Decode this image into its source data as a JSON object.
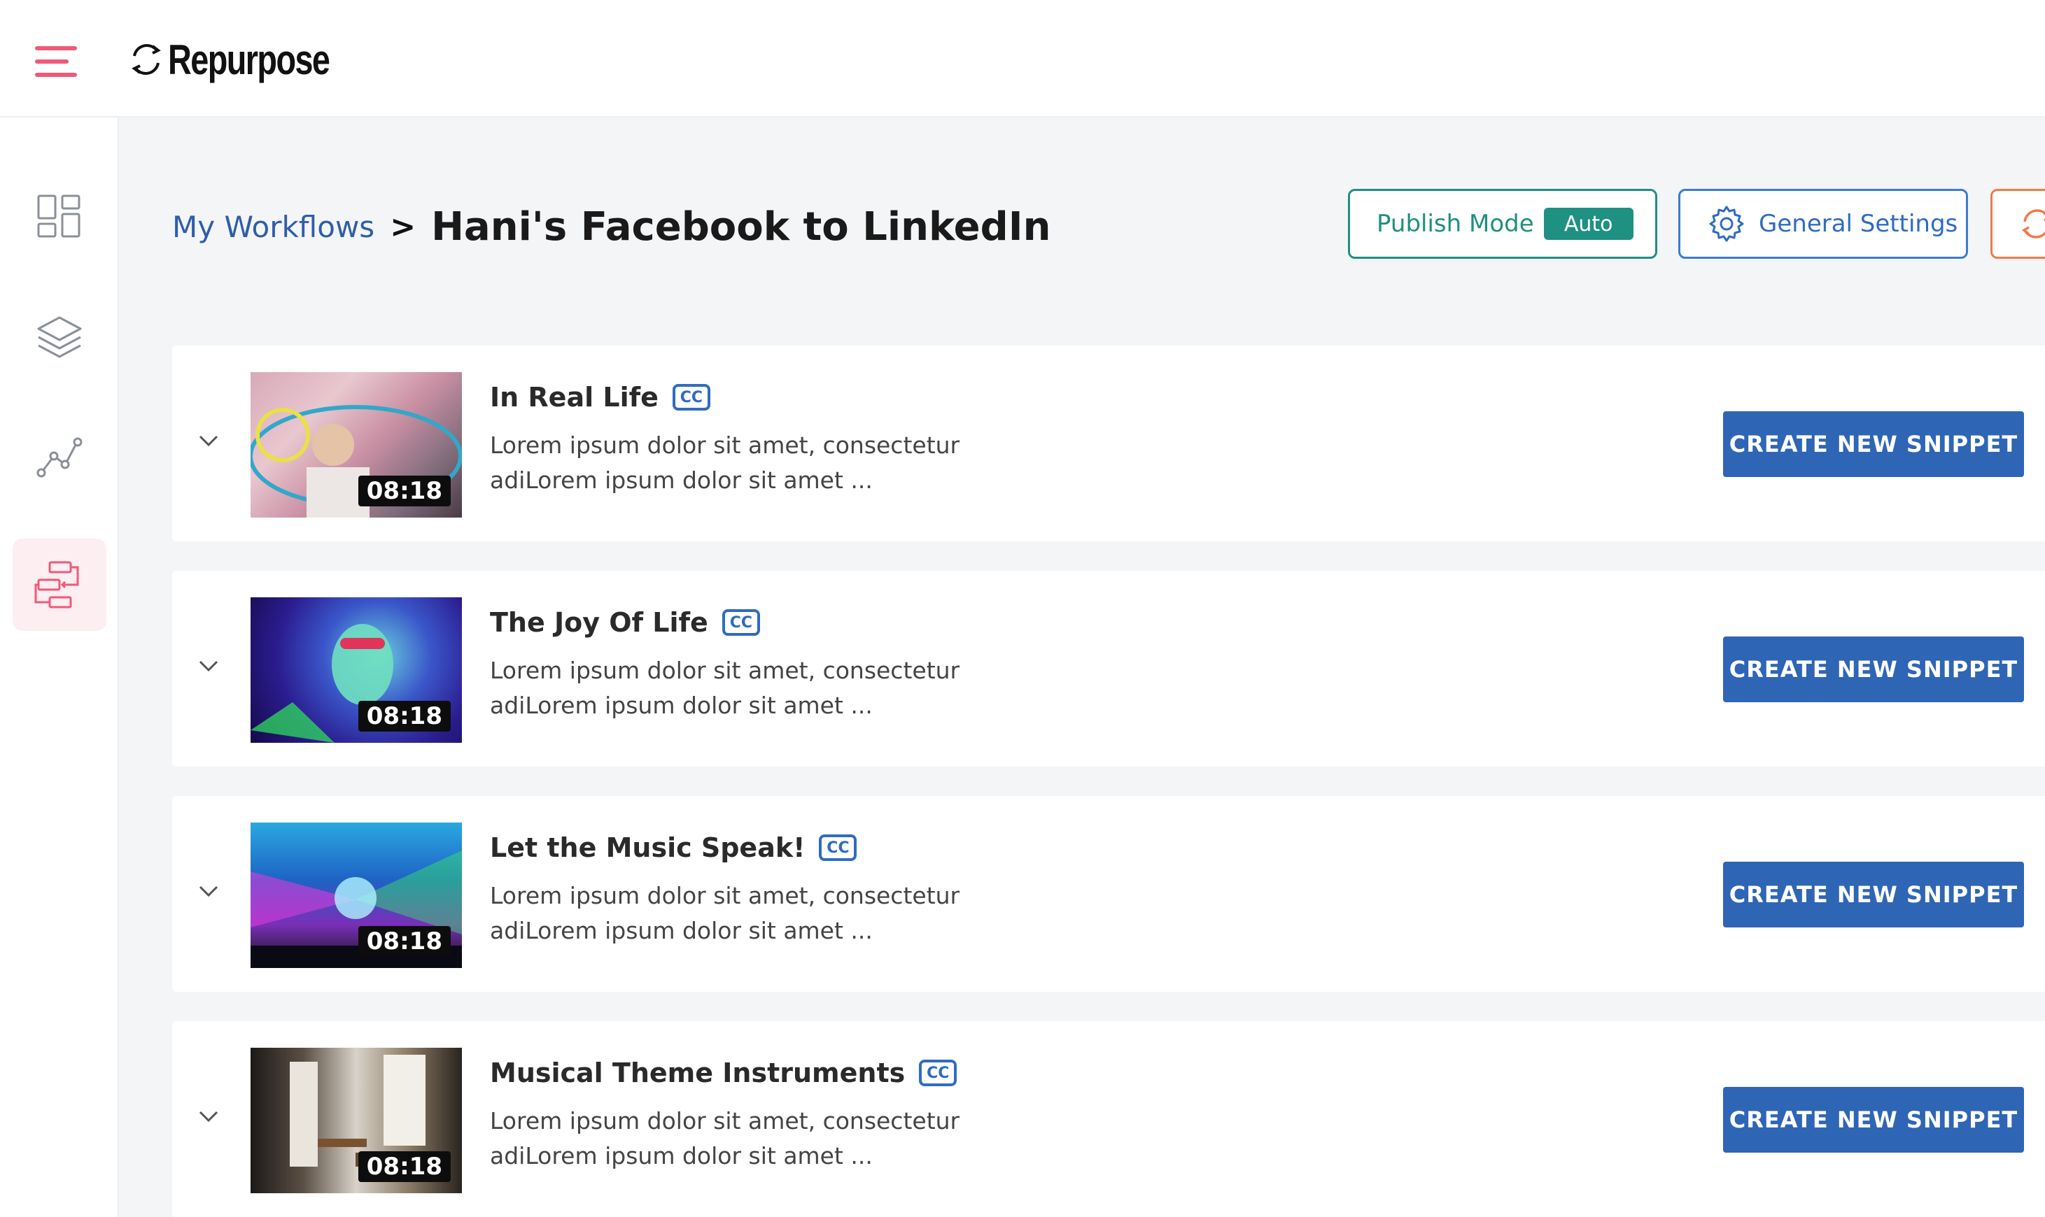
{
  "app": {
    "name": "Repurpose"
  },
  "colors": {
    "accent": "#ee5a78",
    "primary": "#2f65b5",
    "teal": "#1f8f81",
    "orange": "#f07a4a"
  },
  "sidebar": {
    "items": [
      {
        "icon": "dashboard-icon",
        "active": false
      },
      {
        "icon": "layers-icon",
        "active": false
      },
      {
        "icon": "analytics-icon",
        "active": false
      },
      {
        "icon": "workflow-icon",
        "active": true
      }
    ]
  },
  "breadcrumb": {
    "parent": "My Workflows",
    "separator": ">",
    "current": "Hani's Facebook to LinkedIn"
  },
  "header": {
    "publish_mode_label": "Publish Mode",
    "publish_mode_value": "Auto",
    "general_settings_label": "General Settings"
  },
  "videos": [
    {
      "title": "In Real Life",
      "cc": "CC",
      "description": "Lorem ipsum dolor sit amet, consectetur adiLorem ipsum dolor sit amet ...",
      "duration": "08:18",
      "button": "CREATE NEW SNIPPET"
    },
    {
      "title": "The Joy Of Life",
      "cc": "CC",
      "description": "Lorem ipsum dolor sit amet, consectetur adiLorem ipsum dolor sit amet ...",
      "duration": "08:18",
      "button": "CREATE NEW SNIPPET"
    },
    {
      "title": "Let the Music Speak!",
      "cc": "CC",
      "description": "Lorem ipsum dolor sit amet, consectetur adiLorem ipsum dolor sit amet ...",
      "duration": "08:18",
      "button": "CREATE NEW SNIPPET"
    },
    {
      "title": "Musical Theme Instruments",
      "cc": "CC",
      "description": "Lorem ipsum dolor sit amet, consectetur adiLorem ipsum dolor sit amet ...",
      "duration": "08:18",
      "button": "CREATE NEW SNIPPET"
    }
  ]
}
